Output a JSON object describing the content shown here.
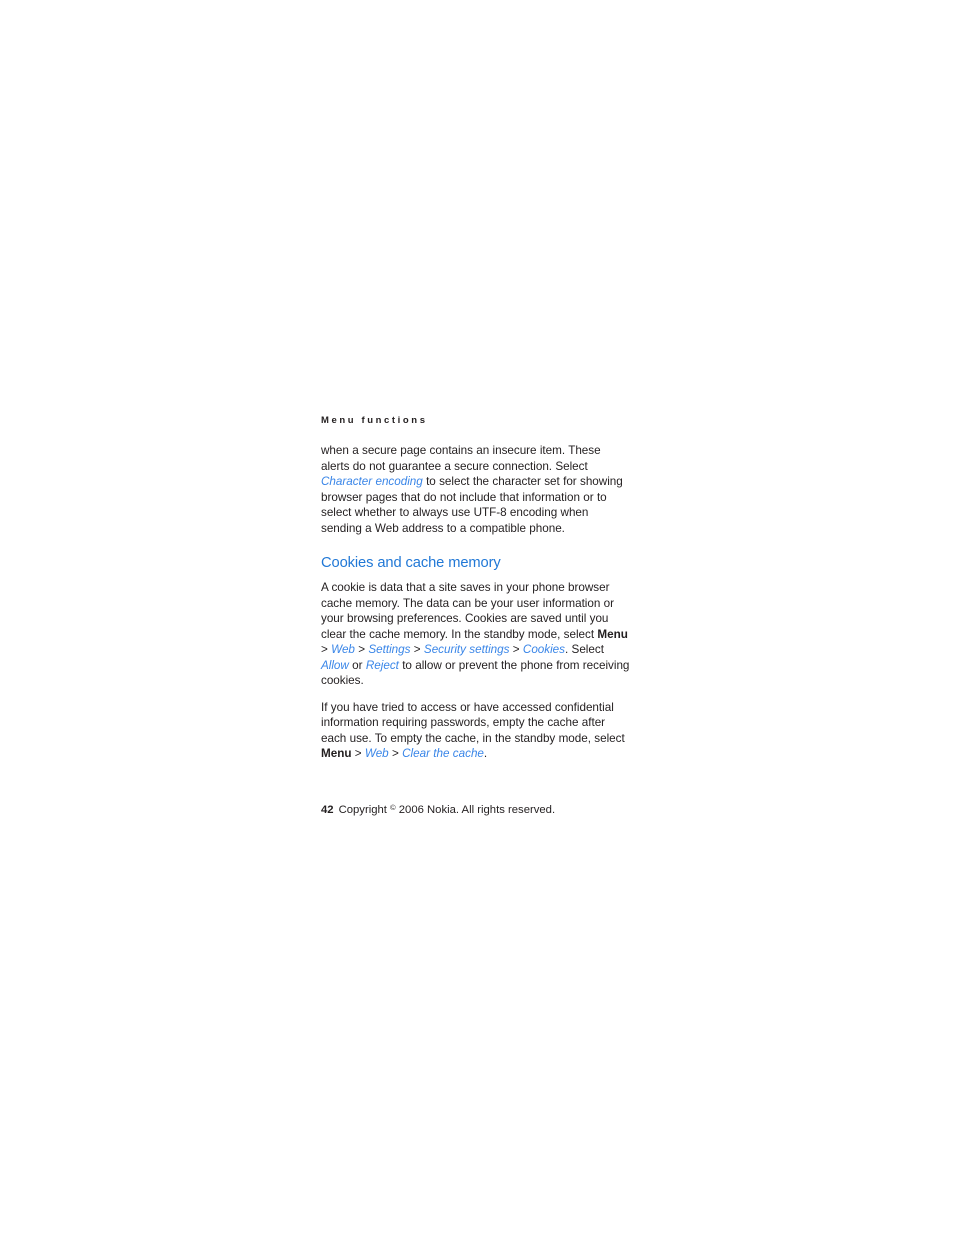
{
  "document": {
    "running_header": "Menu functions",
    "page_number": "42",
    "background_color": "#ffffff",
    "text_color": "#231f20",
    "accent_heading_color": "#2178d6",
    "accent_link_color": "#3a86e8"
  },
  "intro_paragraph": {
    "part1": "when a secure page contains an insecure item. These alerts do not guarantee a secure connection. Select ",
    "link1": "Character encoding",
    "part2": " to select the character set for showing browser pages that do not include that information or to select whether to always use UTF-8 encoding when sending a Web address to a compatible phone."
  },
  "section": {
    "heading": "Cookies and cache memory",
    "paragraph1": {
      "part1": "A cookie is data that a site saves in your phone browser cache memory. The data can be your user information or your browsing preferences. Cookies are saved until you clear the cache memory. In the standby mode, select ",
      "bold1": "Menu",
      "sep1": " > ",
      "link1": "Web",
      "sep2": " > ",
      "link2": "Settings",
      "sep3": " > ",
      "link3": "Security settings",
      "sep4": " > ",
      "link4": "Cookies",
      "part2": ". Select ",
      "link5": "Allow",
      "part3": " or ",
      "link6": "Reject",
      "part4": " to allow or prevent the phone from receiving cookies."
    },
    "paragraph2": {
      "part1": "If you have tried to access or have accessed confidential information requiring passwords, empty the cache after each use. To empty the cache, in the standby mode, select ",
      "bold1": "Menu",
      "sep1": " > ",
      "link1": "Web",
      "sep2": " > ",
      "link2": "Clear the cache",
      "part2": "."
    }
  },
  "footer": {
    "page_number": "42",
    "copyright_prefix": "Copyright ",
    "copyright_symbol": "©",
    "copyright_suffix": " 2006 Nokia. All rights reserved."
  }
}
